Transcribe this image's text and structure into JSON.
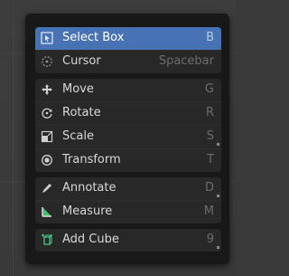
{
  "menu": {
    "groups": [
      {
        "items": [
          {
            "label": "Select Box",
            "key": "B",
            "icon": "select-box-icon",
            "active": true
          },
          {
            "label": "Cursor",
            "key": "Spacebar",
            "icon": "cursor-icon",
            "active": false
          }
        ]
      },
      {
        "items": [
          {
            "label": "Move",
            "key": "G",
            "icon": "move-icon"
          },
          {
            "label": "Rotate",
            "key": "R",
            "icon": "rotate-icon"
          },
          {
            "label": "Scale",
            "key": "S",
            "icon": "scale-icon"
          },
          {
            "label": "Transform",
            "key": "T",
            "icon": "transform-icon"
          }
        ]
      },
      {
        "items": [
          {
            "label": "Annotate",
            "key": "D",
            "icon": "annotate-icon"
          },
          {
            "label": "Measure",
            "key": "M",
            "icon": "measure-icon"
          }
        ]
      },
      {
        "items": [
          {
            "label": "Add Cube",
            "key": "9",
            "icon": "add-cube-icon"
          }
        ]
      }
    ]
  },
  "colors": {
    "accent": "#4772b3",
    "menu_bg": "#181818",
    "item_bg": "#282828"
  }
}
